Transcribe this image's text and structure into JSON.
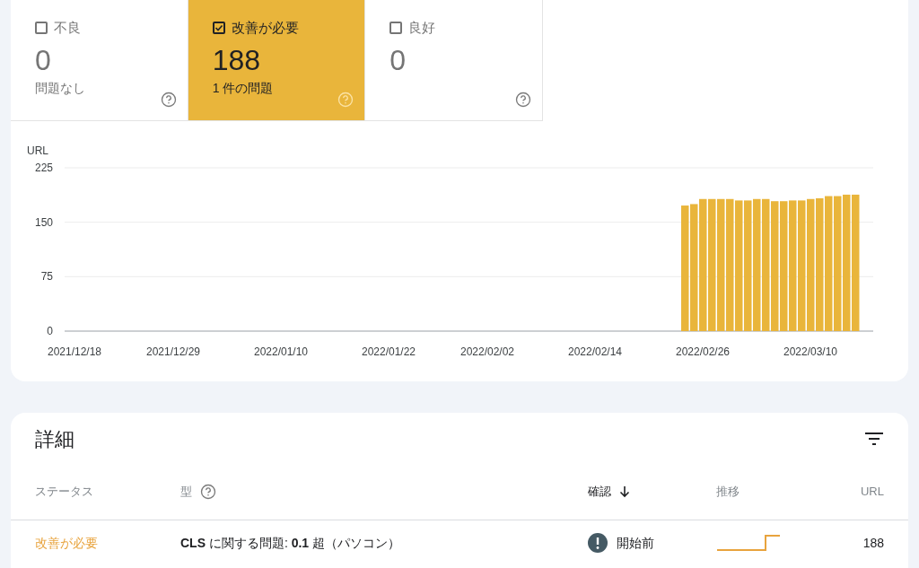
{
  "summary_tiles": [
    {
      "label": "不良",
      "selected": false,
      "count": "0",
      "subtitle": "問題なし"
    },
    {
      "label": "改善が必要",
      "selected": true,
      "count": "188",
      "subtitle": "1 件の問題"
    },
    {
      "label": "良好",
      "selected": false,
      "count": "0"
    }
  ],
  "chart": {
    "chart_data": {
      "type": "bar",
      "ylabel": "URL",
      "categories": [
        "2021/12/18",
        null,
        null,
        null,
        null,
        null,
        null,
        null,
        null,
        null,
        null,
        "2021/12/29",
        null,
        null,
        null,
        null,
        null,
        null,
        null,
        null,
        null,
        null,
        null,
        "2022/01/10",
        null,
        null,
        null,
        null,
        null,
        null,
        null,
        null,
        null,
        null,
        null,
        "2022/01/22",
        null,
        null,
        null,
        null,
        null,
        null,
        null,
        null,
        null,
        null,
        "2022/02/02",
        null,
        null,
        null,
        null,
        null,
        null,
        null,
        null,
        null,
        null,
        null,
        "2022/02/14",
        null,
        null,
        null,
        null,
        null,
        null,
        null,
        null,
        null,
        null,
        null,
        "2022/02/26",
        null,
        null,
        null,
        null,
        null,
        null,
        null,
        null,
        null,
        null,
        null,
        "2022/03/10",
        null,
        null,
        null,
        null,
        null
      ],
      "series": [
        {
          "color": "#e9b53b",
          "values": [
            null,
            null,
            null,
            null,
            null,
            null,
            null,
            null,
            null,
            null,
            null,
            null,
            null,
            null,
            null,
            null,
            null,
            null,
            null,
            null,
            null,
            null,
            null,
            null,
            null,
            null,
            null,
            null,
            null,
            null,
            null,
            null,
            null,
            null,
            null,
            null,
            null,
            null,
            null,
            null,
            null,
            null,
            null,
            null,
            null,
            null,
            null,
            null,
            null,
            null,
            null,
            null,
            null,
            null,
            null,
            null,
            null,
            null,
            null,
            null,
            null,
            null,
            null,
            null,
            null,
            null,
            null,
            null,
            173,
            175,
            182,
            182,
            182,
            182,
            180,
            180,
            182,
            182,
            179,
            179,
            180,
            180,
            182,
            183,
            186,
            186,
            188,
            188
          ]
        }
      ],
      "ylim": [
        0,
        225
      ],
      "yticks": [
        0,
        75,
        150,
        225
      ]
    }
  },
  "details": {
    "title": "詳細",
    "columns": [
      {
        "label": "ステータス"
      },
      {
        "label": "型",
        "help": true
      },
      {
        "label": "確認",
        "sorted": true
      },
      {
        "label": "推移"
      },
      {
        "label": "URL"
      }
    ],
    "rows": [
      {
        "status": "改善が必要",
        "type": "**CLS** に関する問題: **0.1** 超（パソコン）",
        "validation": "開始前",
        "urls": "188"
      }
    ]
  }
}
